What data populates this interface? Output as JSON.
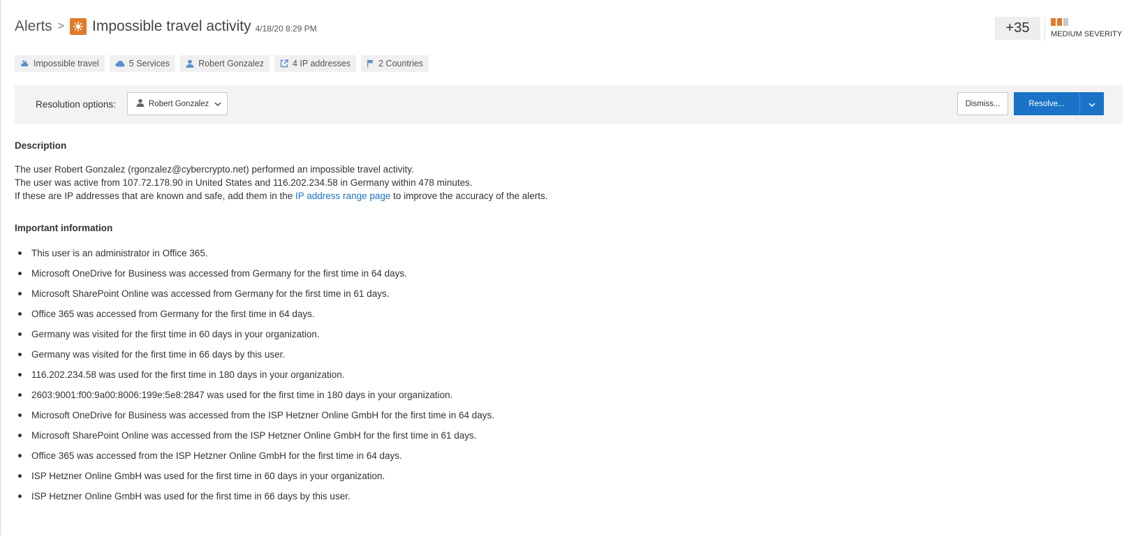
{
  "header": {
    "breadcrumb_root": "Alerts",
    "breadcrumb_sep": ">",
    "title": "Impossible travel activity",
    "timestamp": "4/18/20 8:29 PM"
  },
  "score": {
    "value": "+35"
  },
  "severity": {
    "label": "MEDIUM SEVERITY",
    "level": 2,
    "max": 3,
    "active_color": "#e07b2a",
    "inactive_color": "#c8c8c8"
  },
  "pills": [
    {
      "icon": "impossible-travel-icon",
      "label": "Impossible travel"
    },
    {
      "icon": "cloud-icon",
      "label": "5 Services"
    },
    {
      "icon": "user-icon",
      "label": "Robert Gonzalez"
    },
    {
      "icon": "external-link-icon",
      "label": "4 IP addresses"
    },
    {
      "icon": "flag-icon",
      "label": "2 Countries"
    }
  ],
  "resolution": {
    "label": "Resolution options:",
    "selected_user": "Robert Gonzalez",
    "dismiss_label": "Dismiss...",
    "resolve_label": "Resolve..."
  },
  "description": {
    "heading": "Description",
    "line1": "The user Robert Gonzalez (rgonzalez@cybercrypto.net) performed an impossible travel activity.",
    "line2": "The user was active from 107.72.178.90 in United States and 116.202.234.58 in Germany within 478 minutes.",
    "line3_before": "If these are IP addresses that are known and safe, add them in the",
    "line3_link": "IP address range page",
    "line3_after": "to improve the accuracy of the alerts."
  },
  "important": {
    "heading": "Important information",
    "items": [
      "This user is an administrator in Office 365.",
      "Microsoft OneDrive for Business was accessed from Germany for the first time in 64 days.",
      "Microsoft SharePoint Online was accessed from Germany for the first time in 61 days.",
      "Office 365 was accessed from Germany for the first time in 64 days.",
      "Germany was visited for the first time in 60 days in your organization.",
      "Germany was visited for the first time in 66 days by this user.",
      "116.202.234.58 was used for the first time in 180 days in your organization.",
      "2603:9001:f00:9a00:8006:199e:5e8:2847 was used for the first time in 180 days in your organization.",
      "Microsoft OneDrive for Business was accessed from the ISP Hetzner Online GmbH for the first time in 64 days.",
      "Microsoft SharePoint Online was accessed from the ISP Hetzner Online GmbH for the first time in 61 days.",
      "Office 365 was accessed from the ISP Hetzner Online GmbH for the first time in 64 days.",
      "ISP Hetzner Online GmbH was used for the first time in 60 days in your organization.",
      "ISP Hetzner Online GmbH was used for the first time in 66 days by this user."
    ]
  }
}
